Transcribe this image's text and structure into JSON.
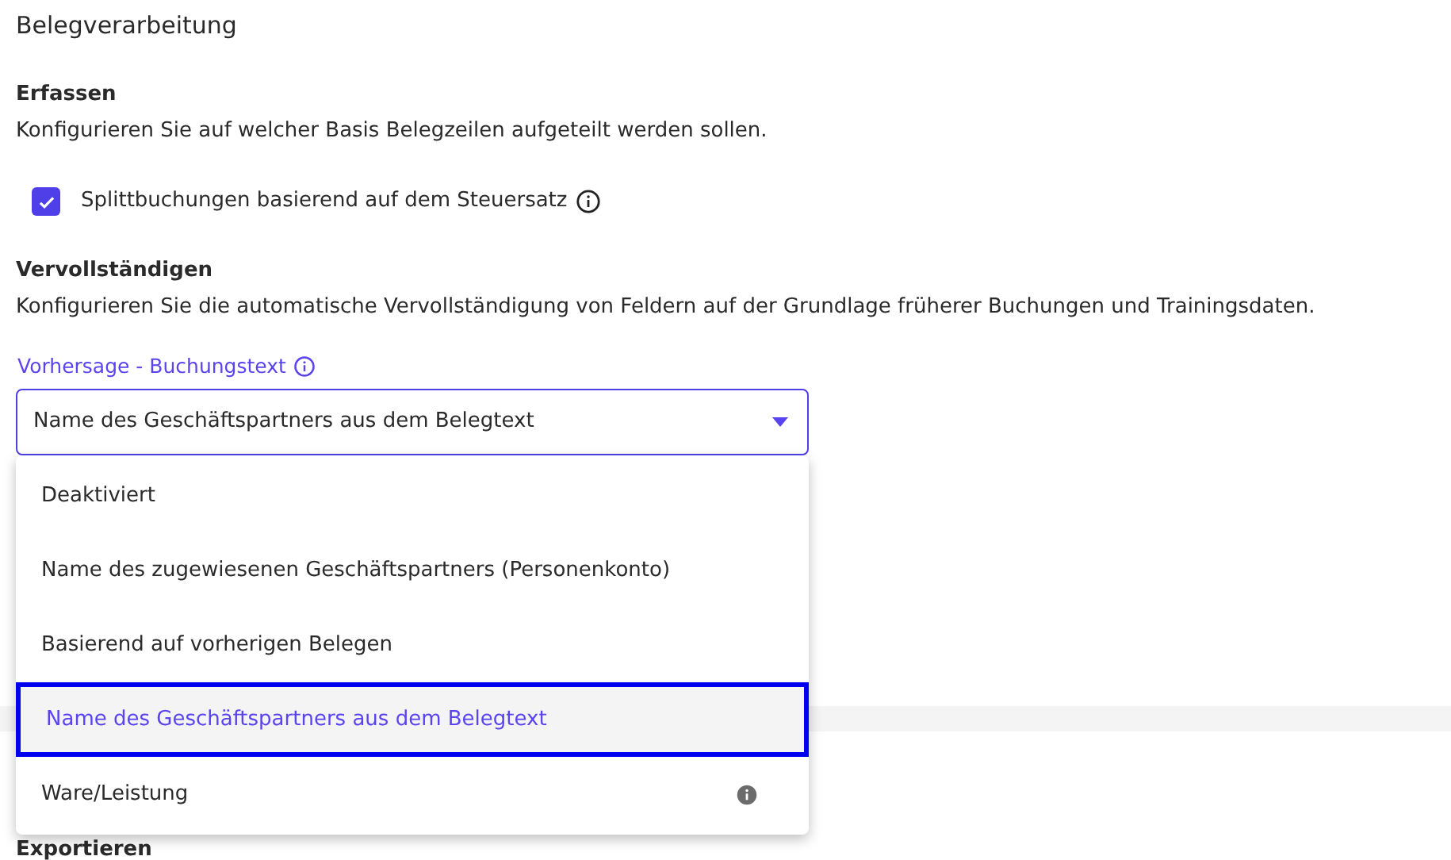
{
  "title": "Belegverarbeitung",
  "sections": [
    {
      "heading": "Erfassen",
      "description": "Konfigurieren Sie auf welcher Basis Belegzeilen aufgeteilt werden sollen."
    }
  ],
  "checkbox": {
    "label": "Splittbuchungen basierend auf dem Steuersatz",
    "checked": true
  },
  "section2": {
    "heading": "Vervollständigen",
    "description": "Konfigurieren Sie die automatische Vervollständigung von Feldern auf der Grundlage früherer Buchungen und Trainingsdaten."
  },
  "select": {
    "label": "Vorhersage - Buchungstext",
    "value": "Name des Geschäftspartners aus dem Belegtext",
    "expanded": true,
    "options": [
      {
        "label": "Deaktiviert",
        "selected": false,
        "info": false
      },
      {
        "label": "Name des zugewiesenen Geschäftspartners (Personenkonto)",
        "selected": false,
        "info": false
      },
      {
        "label": "Basierend auf vorherigen Belegen",
        "selected": false,
        "info": false
      },
      {
        "label": "Name des Geschäftspartners aus dem Belegtext",
        "selected": true,
        "info": false
      },
      {
        "label": "Ware/Leistung",
        "selected": false,
        "info": true
      }
    ]
  },
  "next_heading": "Exportieren"
}
